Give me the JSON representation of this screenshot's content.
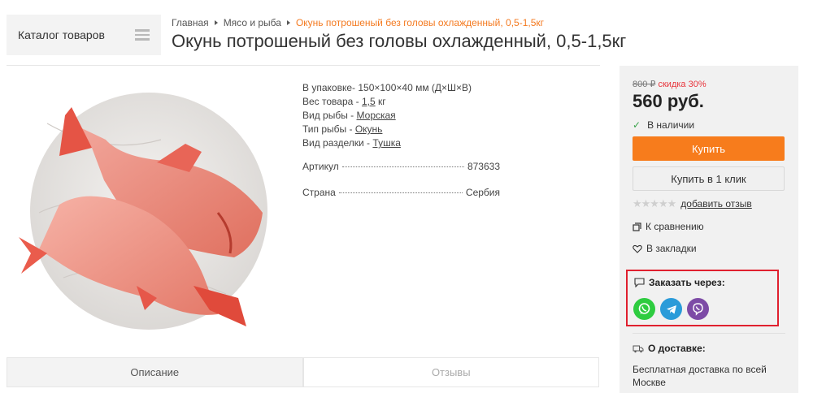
{
  "catalog": {
    "label": "Каталог товаров",
    "icon": "menu-icon"
  },
  "breadcrumb": {
    "items": [
      "Главная",
      "Мясо и рыба"
    ],
    "current": "Окунь потрошеный без головы охлажденный, 0,5-1,5кг"
  },
  "page_title": "Окунь потрошеный без головы охлажденный, 0,5-1,5кг",
  "specs": {
    "package_label": "В упаковке-",
    "package_value": "150×100×40 мм (Д×Ш×В)",
    "weight_label": "Вес товара -",
    "weight_value": "1,5",
    "weight_unit": "кг",
    "fish_kind_label": "Вид рыбы -",
    "fish_kind_value": "Морская",
    "fish_type_label": "Тип рыбы -",
    "fish_type_value": "Окунь",
    "cut_label": "Вид разделки -",
    "cut_value": "Тушка",
    "article_label": "Артикул",
    "article_value": "873633",
    "country_label": "Страна",
    "country_value": "Сербия"
  },
  "tabs": [
    {
      "label": "Описание",
      "active": true
    },
    {
      "label": "Отзывы",
      "active": false
    }
  ],
  "pricing": {
    "old_price": "800 ₽",
    "discount": "скидка 30%",
    "price": "560 руб.",
    "stock": "В наличии"
  },
  "buttons": {
    "buy": "Купить",
    "one_click": "Купить в 1 клик"
  },
  "rating": {
    "stars": 0,
    "max": 5,
    "add_review": "добавить отзыв"
  },
  "compare": "К сравнению",
  "bookmarks": "В закладки",
  "order_via": {
    "title": "Заказать через:",
    "messengers": [
      "whatsapp-icon",
      "telegram-icon",
      "viber-icon"
    ]
  },
  "delivery": {
    "title": "О доставке:",
    "text": "Бесплатная доставка по всей Москве"
  },
  "colors": {
    "accent": "#f77c1c",
    "discount": "#e8353c",
    "breadcrumb_current": "#f47a20",
    "highlight_border": "#e0202f",
    "whatsapp": "#2ecc40",
    "telegram": "#2a9bd9",
    "viber": "#7d4ba6"
  }
}
